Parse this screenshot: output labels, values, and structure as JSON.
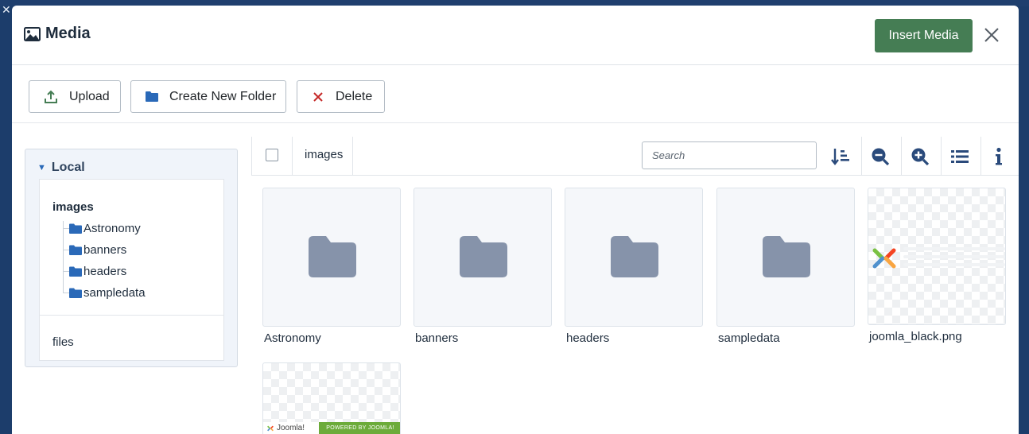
{
  "modal": {
    "title": "Media",
    "insert_label": "Insert Media"
  },
  "toolbar": {
    "upload_label": "Upload",
    "create_folder_label": "Create New Folder",
    "delete_label": "Delete"
  },
  "sidebar": {
    "disk_label": "Local",
    "root_label": "images",
    "folders": [
      "Astronomy",
      "banners",
      "headers",
      "sampledata"
    ],
    "second_root_label": "files"
  },
  "browser": {
    "breadcrumb": "images",
    "search_placeholder": "Search",
    "items": [
      {
        "name": "Astronomy",
        "type": "folder"
      },
      {
        "name": "banners",
        "type": "folder"
      },
      {
        "name": "headers",
        "type": "folder"
      },
      {
        "name": "sampledata",
        "type": "folder"
      },
      {
        "name": "joomla_black.png",
        "type": "image"
      },
      {
        "name": "",
        "type": "image"
      }
    ],
    "thumbnail_texts": {
      "logo_word": "Joomla!",
      "powered_by": "POWERED BY JOOMLA!"
    }
  },
  "icons": {
    "title": "image-icon",
    "upload": "upload-icon",
    "folder": "folder-icon",
    "delete": "x-icon",
    "close": "close-icon",
    "sort": "sort-icon",
    "zoom_out": "zoom-out-icon",
    "zoom_in": "zoom-in-icon",
    "list": "list-view-icon",
    "info": "info-icon"
  },
  "colors": {
    "primary_button": "#457d54",
    "accent_blue": "#2a69b8",
    "folder_gray": "#8693aa",
    "delete_red": "#c52827",
    "joomla_green": "#6cab3a"
  }
}
